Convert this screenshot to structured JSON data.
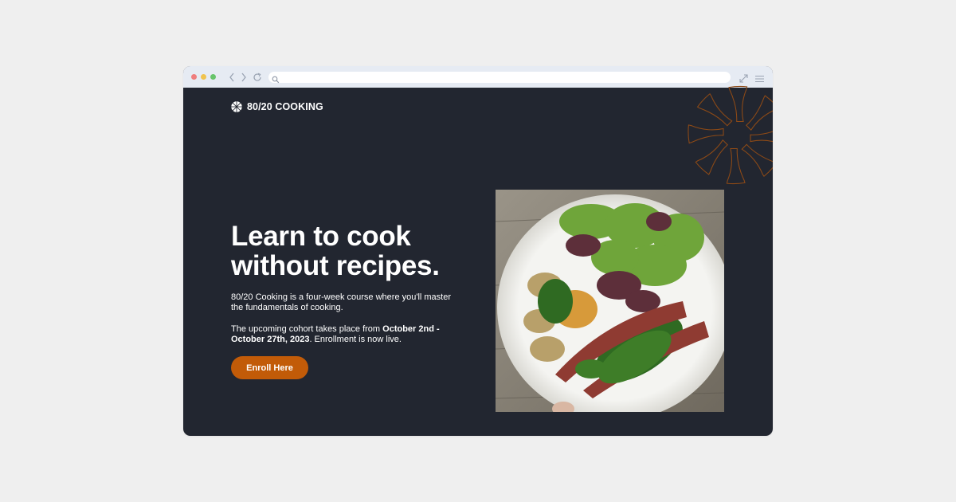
{
  "brand": {
    "name": "80/20 COOKING",
    "accent_color": "#c25b08",
    "background_color": "#222630"
  },
  "browser": {
    "address_placeholder": ""
  },
  "hero": {
    "headline_line1": "Learn to cook",
    "headline_line2": "without recipes.",
    "paragraph1": "80/20 Cooking is a four-week course where you'll master the fundamentals of cooking.",
    "paragraph2_prefix": "The upcoming cohort takes place from ",
    "paragraph2_dates": "October 2nd - October 27th, 2023",
    "paragraph2_suffix": ". Enrollment is now live.",
    "cta_label": "Enroll Here"
  },
  "icons": {
    "logo": "citrus-wheel-icon",
    "decoration": "citrus-wheel-outline-icon",
    "back": "chevron-left-icon",
    "forward": "chevron-right-icon",
    "reload": "reload-icon",
    "search": "search-icon",
    "expand": "expand-icon",
    "menu": "hamburger-menu-icon"
  }
}
